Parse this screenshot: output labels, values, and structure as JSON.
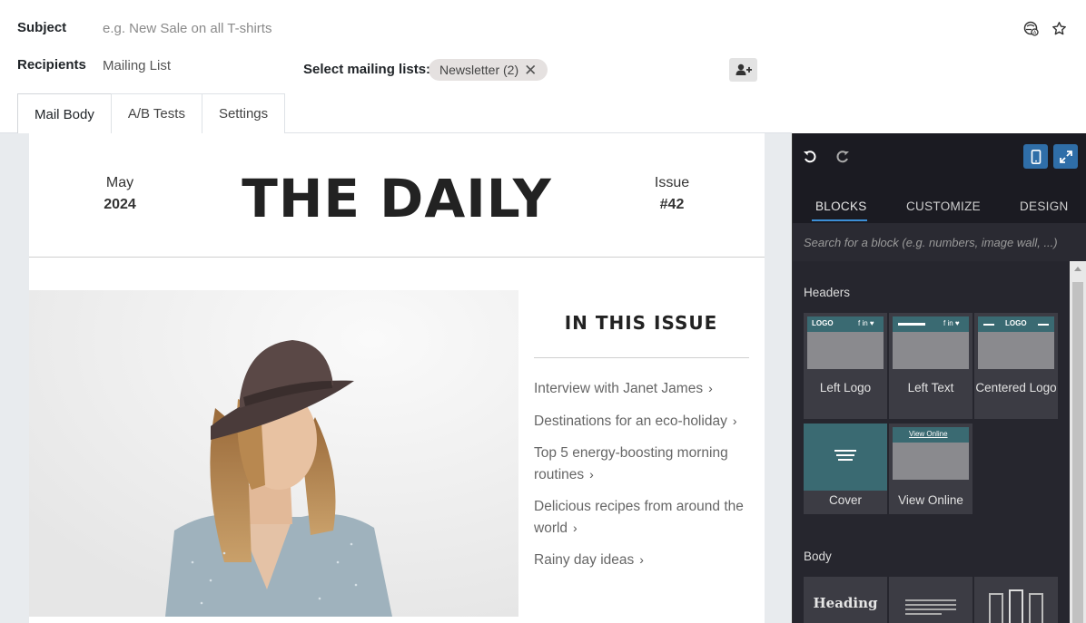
{
  "form": {
    "subject_label": "Subject",
    "subject_placeholder": "e.g. New Sale on all T-shirts",
    "recipients_label": "Recipients",
    "recipients_value": "Mailing List",
    "lists_label": "Select mailing lists:",
    "list_tag": "Newsletter (2)",
    "list_tag_remove": "✕"
  },
  "tabs": [
    "Mail Body",
    "A/B Tests",
    "Settings"
  ],
  "mail": {
    "month": "May",
    "year": "2024",
    "masthead": "THE DAILY",
    "issue_label": "Issue",
    "issue_number": "#42",
    "toc_title": "IN THIS ISSUE",
    "toc_items": [
      "Interview with Janet James",
      "Destinations for an eco-holiday",
      "Top 5 energy-boosting morning routines",
      "Delicious recipes from around the world",
      "Rainy day ideas"
    ]
  },
  "panel": {
    "tabs": [
      "BLOCKS",
      "CUSTOMIZE",
      "DESIGN"
    ],
    "search_placeholder": "Search for a block (e.g. numbers, image wall, ...)",
    "sections": {
      "headers": "Headers",
      "body": "Body"
    },
    "header_snippets": [
      "Left Logo",
      "Left Text",
      "Centered Logo",
      "Cover",
      "View Online"
    ],
    "body_snippets": [
      "Heading"
    ],
    "thumb_text": {
      "logo": "LOGO",
      "social": "f in ♥",
      "view_online": "View Online"
    }
  },
  "colors": {
    "panel_bg": "#1b1b22",
    "accent": "#3c8fd6",
    "device_button": "#2f6ea8",
    "tag_bg": "#e5e1e0"
  }
}
